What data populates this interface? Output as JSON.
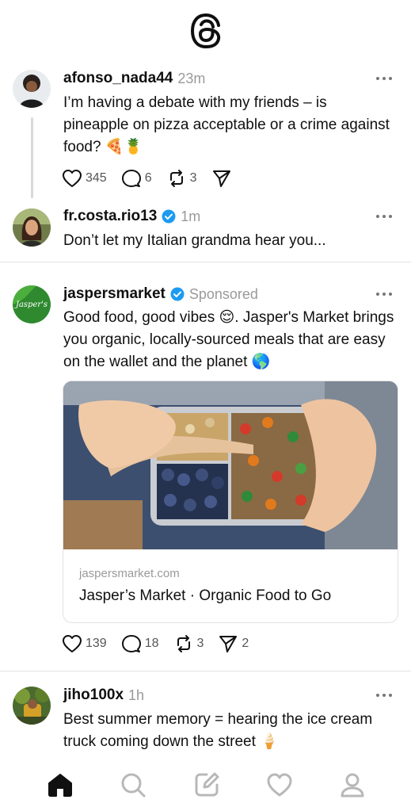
{
  "app": {
    "logo_icon": "threads-logo-icon"
  },
  "posts": [
    {
      "username": "afonso_nada44",
      "time": "23m",
      "text": "I’m having a debate with my friends – is pineapple on pizza acceptable or a crime against food? 🍕🍍",
      "likes": "345",
      "replies": "6",
      "reposts": "3"
    },
    {
      "username": "fr.costa.rio13",
      "time": "1m",
      "verified": true,
      "text": "Don’t let my Italian grandma hear you..."
    },
    {
      "username": "jaspersmarket",
      "avatar_text": "Jasper's",
      "verified": true,
      "label": "Sponsored",
      "text": "Good food, good vibes 😌. Jasper's Market brings you organic, locally-sourced meals that are easy on the wallet and the planet 🌎",
      "link": {
        "domain": "jaspersmarket.com",
        "title": "Jasper’s Market · Organic Food to Go"
      },
      "likes": "139",
      "replies": "18",
      "reposts": "3",
      "shares": "2"
    },
    {
      "username": "jiho100x",
      "time": "1h",
      "text": "Best summer memory = hearing the ice cream truck coming down the street 🍦"
    }
  ],
  "tabbar": {
    "items": [
      "home-icon",
      "search-icon",
      "compose-icon",
      "activity-heart-icon",
      "profile-icon"
    ],
    "active": "home-icon"
  },
  "colors": {
    "verified": "#1d9bf0",
    "text": "#101010",
    "muted": "#9a9a9a",
    "divider": "#e3e3e3"
  }
}
